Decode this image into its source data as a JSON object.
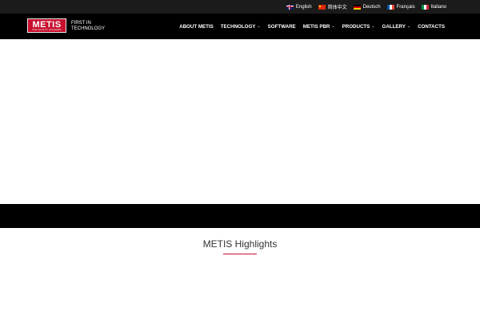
{
  "languages": [
    {
      "label": "English",
      "flag": "uk-flag-icon"
    },
    {
      "label": "简体中文",
      "flag": "china-flag-icon"
    },
    {
      "label": "Deutsch",
      "flag": "germany-flag-icon"
    },
    {
      "label": "Français",
      "flag": "france-flag-icon"
    },
    {
      "label": "Italiano",
      "flag": "italy-flag-icon"
    }
  ],
  "brand": {
    "logo_text": "METIS",
    "logo_subtext": "HIGH QUALITY SCANNERS",
    "tagline_line1": "FIRST IN",
    "tagline_line2": "TECHNOLOGY",
    "accent_color": "#c8102e"
  },
  "nav": {
    "items": [
      {
        "label": "ABOUT METIS",
        "dropdown": false
      },
      {
        "label": "TECHNOLOGY",
        "dropdown": true
      },
      {
        "label": "SOFTWARE",
        "dropdown": false
      },
      {
        "label": "METIS PBR",
        "dropdown": true
      },
      {
        "label": "PRODUCTS",
        "dropdown": true
      },
      {
        "label": "GALLERY",
        "dropdown": true
      },
      {
        "label": "CONTACTS",
        "dropdown": false
      }
    ],
    "chevron_icon": "chevron-down-icon"
  },
  "main": {
    "section_title": "METIS Highlights"
  }
}
